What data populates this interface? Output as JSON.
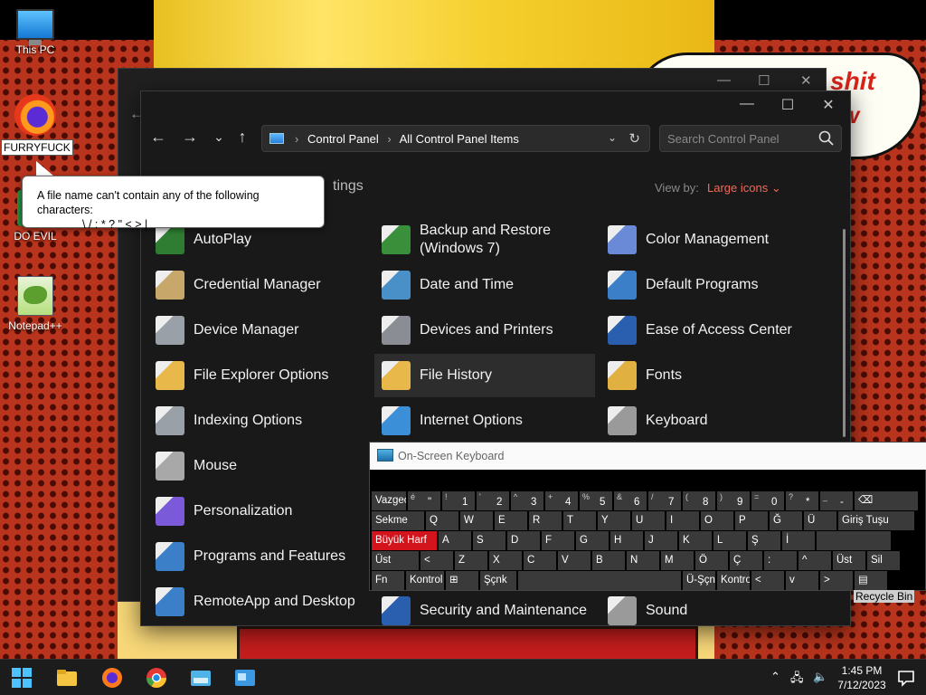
{
  "desktop": {
    "wallpaper_text_1": "shit",
    "wallpaper_text_2": "w",
    "icons": [
      {
        "label": "This PC",
        "icon": "computer-icon"
      },
      {
        "label": "FURRYFUCK",
        "icon": "firefox-icon"
      },
      {
        "label": "DO EVIL",
        "icon": "app-shortcut-icon"
      },
      {
        "label": "Notepad++",
        "icon": "notepadpp-icon"
      }
    ],
    "recycle_bin_label": "Recycle Bin"
  },
  "tooltip": {
    "line1": "A file name can't contain any of the following characters:",
    "line2": "\\ / : * ? \" < > |"
  },
  "explorer": {
    "controls": {
      "minimize": "—",
      "maximize": "☐",
      "close": "✕"
    },
    "nav": {
      "back": "←",
      "forward": "→",
      "recent": "⌄",
      "up": "↑"
    },
    "address": {
      "path": [
        "Control Panel",
        "All Control Panel Items"
      ],
      "separator": "›"
    },
    "search": {
      "placeholder": "Search Control Panel"
    },
    "header": {
      "title_partial": "tings",
      "view_by_label": "View by:",
      "view_by_value": "Large icons ⌄"
    },
    "items": [
      {
        "label": "AutoPlay",
        "icon": "autoplay-icon",
        "color": "#2e7d32"
      },
      {
        "label": "Backup and Restore (Windows 7)",
        "icon": "backup-restore-icon",
        "color": "#3a8f3a"
      },
      {
        "label": "Color Management",
        "icon": "color-management-icon",
        "color": "#6a8ad8"
      },
      {
        "label": "Credential Manager",
        "icon": "credential-manager-icon",
        "color": "#c8a86a"
      },
      {
        "label": "Date and Time",
        "icon": "date-time-icon",
        "color": "#4a90c8"
      },
      {
        "label": "Default Programs",
        "icon": "default-programs-icon",
        "color": "#3a7fc8"
      },
      {
        "label": "Device Manager",
        "icon": "device-manager-icon",
        "color": "#9aa0a8"
      },
      {
        "label": "Devices and Printers",
        "icon": "devices-printers-icon",
        "color": "#8a8e94"
      },
      {
        "label": "Ease of Access Center",
        "icon": "ease-of-access-icon",
        "color": "#2a5fb0"
      },
      {
        "label": "File Explorer Options",
        "icon": "folder-options-icon",
        "color": "#e8b84a"
      },
      {
        "label": "File History",
        "icon": "file-history-icon",
        "color": "#e8b84a"
      },
      {
        "label": "Fonts",
        "icon": "fonts-icon",
        "color": "#e0b040"
      },
      {
        "label": "Indexing Options",
        "icon": "indexing-options-icon",
        "color": "#9aa0a8"
      },
      {
        "label": "Internet Options",
        "icon": "internet-options-icon",
        "color": "#3a8fd8"
      },
      {
        "label": "Keyboard",
        "icon": "keyboard-icon",
        "color": "#9a9a9a"
      },
      {
        "label": "Mouse",
        "icon": "mouse-icon",
        "color": "#a8a8a8"
      },
      {
        "label": "Personalization",
        "icon": "personalization-icon",
        "color": "#7a5ad8"
      },
      {
        "label": "Programs and Features",
        "icon": "programs-features-icon",
        "color": "#3a7fc8"
      },
      {
        "label": "RemoteApp and Desktop",
        "icon": "remoteapp-icon",
        "color": "#3a7fc8"
      },
      {
        "label": "Security and Maintenance",
        "icon": "security-maintenance-icon",
        "color": "#2a5fb0"
      },
      {
        "label": "Sound",
        "icon": "sound-icon",
        "color": "#9a9a9a"
      }
    ]
  },
  "osk": {
    "title": "On-Screen Keyboard",
    "row1": [
      {
        "main": "Vazgeç"
      },
      {
        "sh": "é",
        "main": "\""
      },
      {
        "sh": "!",
        "main": "1"
      },
      {
        "sh": "'",
        "main": "2"
      },
      {
        "sh": "^",
        "main": "3"
      },
      {
        "sh": "+",
        "main": "4"
      },
      {
        "sh": "%",
        "main": "5"
      },
      {
        "sh": "&",
        "main": "6"
      },
      {
        "sh": "/",
        "main": "7"
      },
      {
        "sh": "(",
        "main": "8"
      },
      {
        "sh": ")",
        "main": "9"
      },
      {
        "sh": "=",
        "main": "0"
      },
      {
        "sh": "?",
        "main": "*"
      },
      {
        "sh": "_",
        "main": "-"
      },
      {
        "main": "⌫"
      }
    ],
    "row2": [
      "Sekme",
      "Q",
      "W",
      "E",
      "R",
      "T",
      "Y",
      "U",
      "I",
      "O",
      "P",
      "Ğ",
      "Ü",
      "Giriş Tuşu"
    ],
    "row3": [
      "Büyük Harf",
      "A",
      "S",
      "D",
      "F",
      "G",
      "H",
      "J",
      "K",
      "L",
      "Ş",
      "İ"
    ],
    "row4": [
      "Üst",
      "<",
      "Z",
      "X",
      "C",
      "V",
      "B",
      "N",
      "M",
      "Ö",
      "Ç",
      ":",
      "^",
      "Üst",
      "Sil"
    ],
    "row5": [
      "Fn",
      "Kontrol",
      "⊞",
      "Şçnk",
      "",
      "Ü-Şçnk",
      "Kontrol",
      "<",
      "v",
      ">",
      "▤"
    ]
  },
  "taskbar": {
    "time": "1:45 PM",
    "date": "7/12/2023",
    "apps": [
      "start-icon",
      "file-explorer-icon",
      "firefox-icon",
      "chrome-icon",
      "osk-taskbar-icon",
      "control-panel-taskbar-icon"
    ]
  }
}
